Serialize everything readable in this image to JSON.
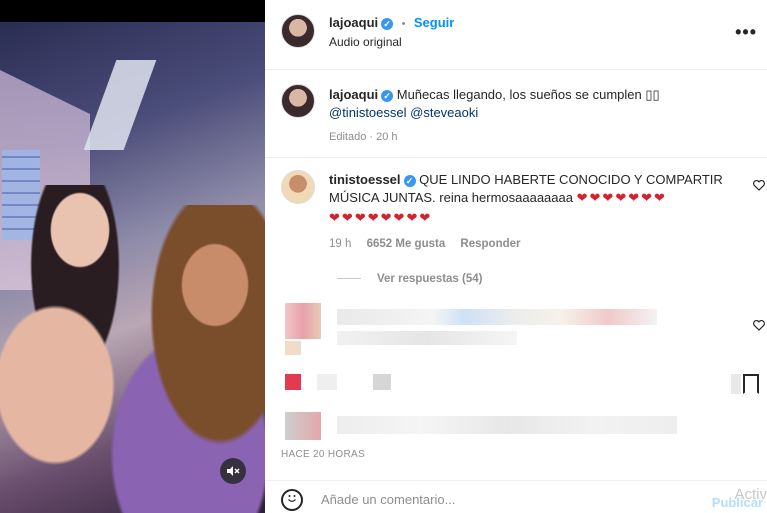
{
  "post_header": {
    "username": "lajoaqui",
    "verified_mark": "✓",
    "follow_label": "Seguir",
    "audio_label": "Audio original",
    "more_label": "•••"
  },
  "caption": {
    "username": "lajoaqui",
    "text": "Muñecas llegando, los sueños se cumplen",
    "text_suffix": "▯▯",
    "mentions": [
      "@tinistoessel",
      "@steveaoki"
    ],
    "meta": "Editado · 20 h"
  },
  "top_comment": {
    "username": "tinistoessel",
    "text": "QUE LINDO HABERTE CONOCIDO Y COMPARTIR MÚSICA JUNTAS. reina hermosaaaaaaaa",
    "hearts_line1": [
      "❤",
      "❤",
      "❤",
      "❤",
      "❤",
      "❤",
      "❤"
    ],
    "hearts_line2": [
      "❤",
      "❤",
      "❤",
      "❤",
      "❤",
      "❤",
      "❤",
      "❤"
    ],
    "age": "19 h",
    "likes": "6652 Me gusta",
    "reply_label": "Responder",
    "view_replies": "Ver respuestas (54)"
  },
  "timestamp": "HACE 20 HORAS",
  "footer": {
    "comment_placeholder": "Añade un comentario...",
    "publish_label": "Publicar",
    "watermark": "Activ"
  },
  "icons": {
    "mute": "speaker-muted-icon",
    "heart": "heart-outline-icon",
    "bookmark": "bookmark-icon",
    "emoji": "emoji-icon",
    "more": "more-options-icon"
  },
  "colors": {
    "link_blue": "#0095f6",
    "mention_blue": "#00376b",
    "heart_red": "#d2232f",
    "muted_text": "#8e8e8e"
  }
}
